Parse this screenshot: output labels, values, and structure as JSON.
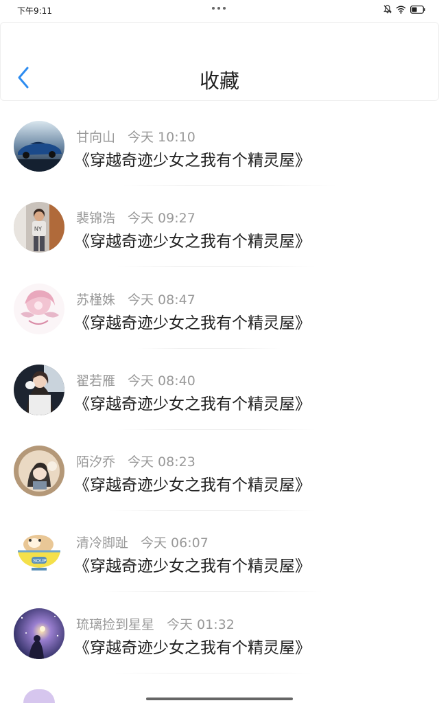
{
  "status_bar": {
    "time": "下午9:11"
  },
  "header": {
    "title": "收藏"
  },
  "favorites": [
    {
      "name": "甘向山",
      "time": "今天 10:10",
      "title": "《穿越奇迹少女之我有个精灵屋》",
      "avatar": "car-avatar-icon"
    },
    {
      "name": "裴锦浩",
      "time": "今天 09:27",
      "title": "《穿越奇迹少女之我有个精灵屋》",
      "avatar": "boy-photo-avatar-icon"
    },
    {
      "name": "苏槿姝",
      "time": "今天 08:47",
      "title": "《穿越奇迹少女之我有个精灵屋》",
      "avatar": "pink-anime-avatar-icon"
    },
    {
      "name": "翟若雁",
      "time": "今天 08:40",
      "title": "《穿越奇迹少女之我有个精灵屋》",
      "avatar": "girl-photo-avatar-icon"
    },
    {
      "name": "陌汐乔",
      "time": "今天 08:23",
      "title": "《穿越奇迹少女之我有个精灵屋》",
      "avatar": "illustrated-girl-avatar-icon"
    },
    {
      "name": "清冷脚趾",
      "time": "今天 06:07",
      "title": "《穿越奇迹少女之我有个精灵屋》",
      "avatar": "hamster-soup-avatar-icon"
    },
    {
      "name": "琉璃捡到星星",
      "time": "今天 01:32",
      "title": "《穿越奇迹少女之我有个精灵屋》",
      "avatar": "starry-night-avatar-icon"
    }
  ],
  "colors": {
    "accent": "#2d8cf0",
    "text_primary": "#222222",
    "text_secondary": "#999999",
    "divider": "#eeeeee"
  }
}
